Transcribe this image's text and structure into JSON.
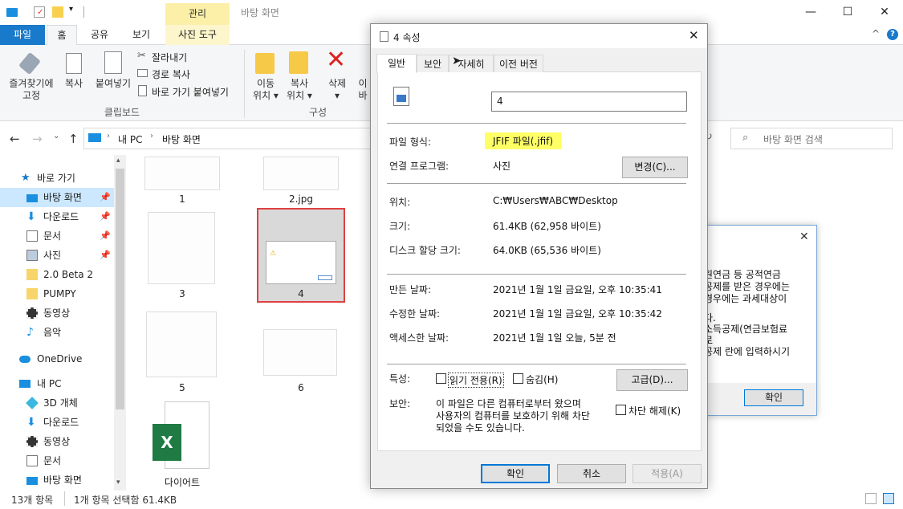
{
  "window": {
    "context_tab_label": "관리",
    "title": "바탕 화면",
    "minimize": "—",
    "maximize": "☐",
    "close": "✕"
  },
  "ribbon_tabs": {
    "file": "파일",
    "home": "홈",
    "share": "공유",
    "view": "보기",
    "picture_tools": "사진 도구",
    "collapse": "^",
    "help": "?"
  },
  "ribbon": {
    "pin_quick_access": "즐겨찾기에\n고정",
    "copy": "복사",
    "paste": "붙여넣기",
    "cut": "잘라내기",
    "copy_path": "경로 복사",
    "paste_shortcut": "바로 가기 붙여넣기",
    "clipboard_group": "클립보드",
    "move_to": "이동\n위치 ▾",
    "copy_to": "복사\n위치 ▾",
    "delete": "삭제\n▾",
    "rename_partial": "이\n바",
    "organize_group": "구성"
  },
  "nav": {
    "breadcrumb_pc": "내 PC",
    "breadcrumb_desktop": "바탕 화면",
    "search_placeholder": "바탕 화면 검색"
  },
  "sidebar": {
    "items": [
      {
        "label": "바로 가기",
        "icon": "star-icon"
      },
      {
        "label": "바탕 화면",
        "icon": "desktop-icon",
        "pinned": true,
        "selected": true
      },
      {
        "label": "다운로드",
        "icon": "download-icon",
        "pinned": true
      },
      {
        "label": "문서",
        "icon": "document-icon",
        "pinned": true
      },
      {
        "label": "사진",
        "icon": "picture-icon",
        "pinned": true
      },
      {
        "label": "2.0 Beta 2",
        "icon": "folder-icon"
      },
      {
        "label": "PUMPY",
        "icon": "folder-icon"
      },
      {
        "label": "동영상",
        "icon": "video-icon"
      },
      {
        "label": "음악",
        "icon": "music-icon"
      },
      {
        "label": "OneDrive",
        "icon": "cloud-icon"
      },
      {
        "label": "내 PC",
        "icon": "pc-icon"
      },
      {
        "label": "3D 개체",
        "icon": "cube-icon"
      },
      {
        "label": "다운로드",
        "icon": "download-icon"
      },
      {
        "label": "동영상",
        "icon": "video-icon"
      },
      {
        "label": "문서",
        "icon": "document-icon"
      },
      {
        "label": "바탕 화면",
        "icon": "desktop-icon"
      }
    ]
  },
  "files": [
    "1",
    "2.jpg",
    "3",
    "4",
    "5",
    "6",
    "다이어트"
  ],
  "status": {
    "count": "13개 항목",
    "selection": "1개 항목 선택함 61.4KB"
  },
  "msgbox": {
    "lines": [
      "원연금 등 공적연금",
      "공제를 받은 경우에는",
      "경우에는 과세대상이",
      "",
      "다.",
      "소득공제(연금보험료",
      "로",
      "공제 란에 입력하시기"
    ],
    "ok": "확인",
    "close": "✕"
  },
  "dialog": {
    "title": "4 속성",
    "close": "✕",
    "tabs": [
      "일반",
      "보안",
      "자세히",
      "이전 버전"
    ],
    "filename": "4",
    "file_type_label": "파일 형식:",
    "file_type_value": "JFIF 파일(.jfif)",
    "opens_with_label": "연결 프로그램:",
    "opens_with_value": "사진",
    "change_button": "변경(C)...",
    "location_label": "위치:",
    "location_value": "C:₩Users₩ABC₩Desktop",
    "size_label": "크기:",
    "size_value": "61.4KB (62,958 바이트)",
    "disk_size_label": "디스크 할당 크기:",
    "disk_size_value": "64.0KB (65,536 바이트)",
    "created_label": "만든 날짜:",
    "created_value": "2021년 1월 1일 금요일, 오후 10:35:41",
    "modified_label": "수정한 날짜:",
    "modified_value": "2021년 1월 1일 금요일, 오후 10:35:42",
    "accessed_label": "액세스한 날짜:",
    "accessed_value": "2021년 1월 1일 오늘, 5분 전",
    "attributes_label": "특성:",
    "readonly": "읽기 전용(R)",
    "hidden": "숨김(H)",
    "advanced_button": "고급(D)...",
    "security_label": "보안:",
    "security_text_1": "이 파일은 다른 컴퓨터로부터 왔으며",
    "security_text_2": "사용자의 컴퓨터를 보호하기 위해 차단",
    "security_text_3": "되었을 수도 있습니다.",
    "unblock": "차단 해제(K)",
    "ok": "확인",
    "cancel": "취소",
    "apply": "적용(A)"
  },
  "colors": {
    "accent": "#1979ca",
    "highlight_yellow": "#ffff66",
    "context_tab": "#fcf0a8",
    "selection_red": "#e04040"
  }
}
